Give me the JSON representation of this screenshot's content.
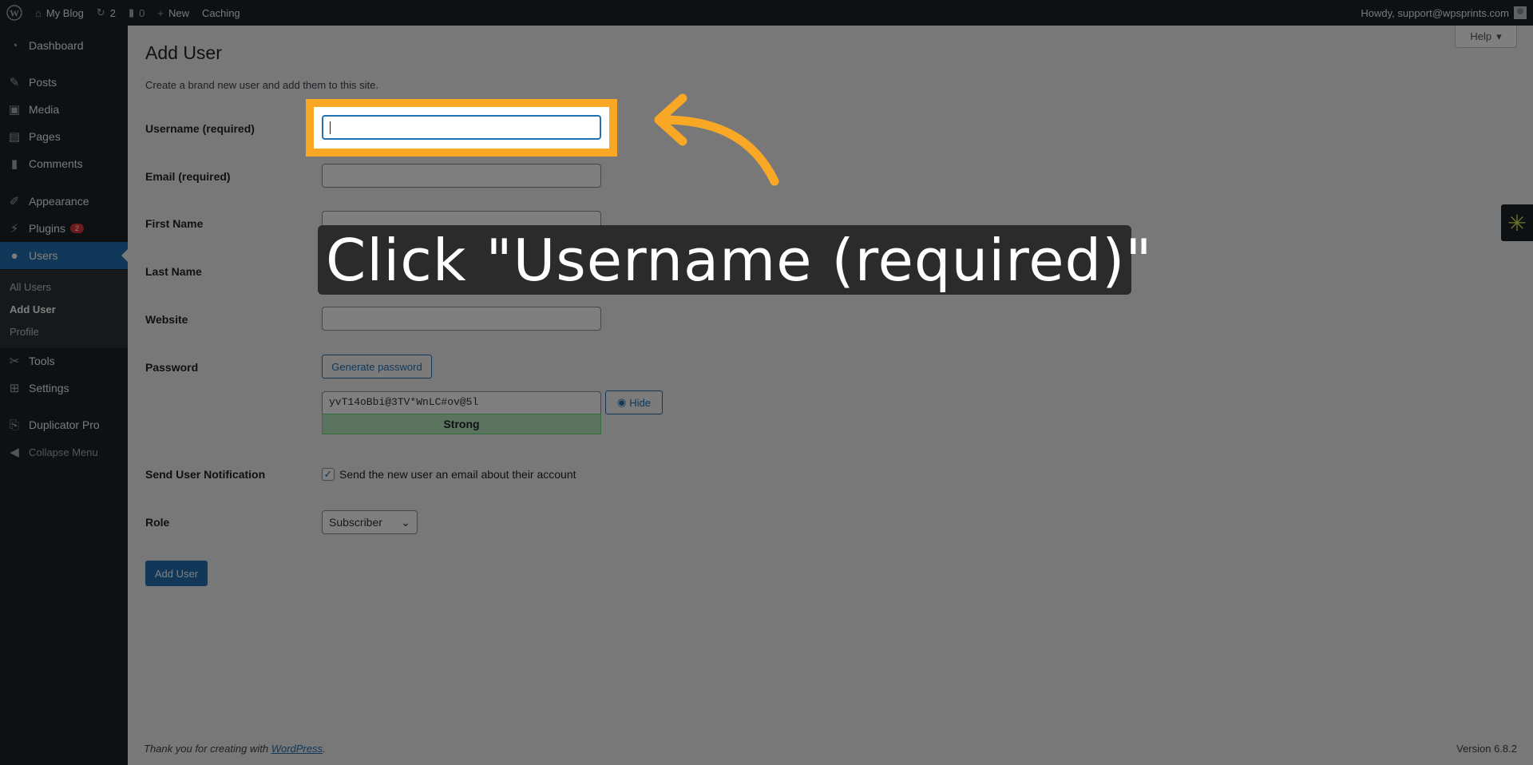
{
  "adminbar": {
    "site_name": "My Blog",
    "updates_count": "2",
    "comments_count": "0",
    "new_label": "New",
    "caching_label": "Caching",
    "howdy": "Howdy, support@wpsprints.com"
  },
  "sidebar": {
    "items": [
      {
        "label": "Dashboard",
        "icon": "dashboard-icon"
      },
      {
        "label": "Posts",
        "icon": "pin-icon"
      },
      {
        "label": "Media",
        "icon": "media-icon"
      },
      {
        "label": "Pages",
        "icon": "pages-icon"
      },
      {
        "label": "Comments",
        "icon": "comment-icon"
      },
      {
        "label": "Appearance",
        "icon": "brush-icon"
      },
      {
        "label": "Plugins",
        "icon": "plug-icon",
        "badge": "2"
      },
      {
        "label": "Users",
        "icon": "user-icon",
        "current": true
      },
      {
        "label": "Tools",
        "icon": "wrench-icon"
      },
      {
        "label": "Settings",
        "icon": "settings-icon"
      },
      {
        "label": "Duplicator Pro",
        "icon": "duplicator-icon"
      },
      {
        "label": "Collapse Menu",
        "icon": "collapse-icon"
      }
    ],
    "submenu": [
      "All Users",
      "Add User",
      "Profile"
    ]
  },
  "page": {
    "help": "Help",
    "title": "Add User",
    "intro": "Create a brand new user and add them to this site.",
    "labels": {
      "username": "Username (required)",
      "email": "Email (required)",
      "first_name": "First Name",
      "last_name": "Last Name",
      "website": "Website",
      "password": "Password",
      "notification": "Send User Notification",
      "role": "Role"
    },
    "generate_password": "Generate password",
    "password_value": "yvT14oBbi@3TV*WnLC#ov@5l",
    "hide": "Hide",
    "strength": "Strong",
    "notification_text": "Send the new user an email about their account",
    "role_value": "Subscriber",
    "submit": "Add User"
  },
  "footer": {
    "thanks_prefix": "Thank you for creating with ",
    "thanks_link": "WordPress",
    "thanks_suffix": ".",
    "version": "Version 6.8.2"
  },
  "overlay": {
    "callout": "Click \"Username (required)\"",
    "highlight_color": "#f9a825"
  }
}
